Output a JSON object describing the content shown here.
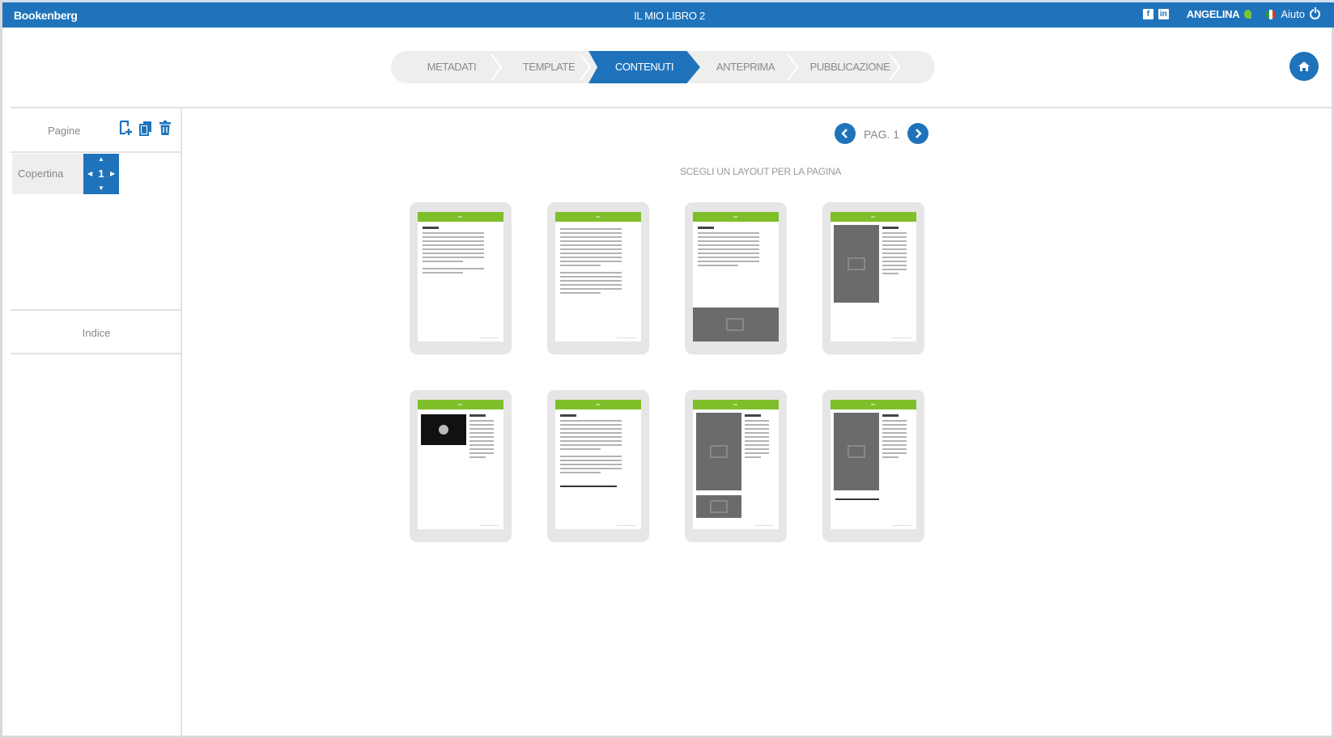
{
  "app": {
    "brand": "Bookenberg",
    "book_title": "IL MIO LIBRO 2",
    "user": "ANGELINA",
    "help_label": "Aiuto"
  },
  "stepper": {
    "steps": [
      "METADATI",
      "TEMPLATE",
      "CONTENUTI",
      "ANTEPRIMA",
      "PUBBLICAZIONE"
    ],
    "active": "CONTENUTI"
  },
  "sidebar": {
    "pages_label": "Pagine",
    "cover_label": "Copertina",
    "cover_page_number": "1",
    "index_label": "Indice"
  },
  "main": {
    "page_label": "PAG. 1",
    "choose_layout_label": "SCEGLI UN LAYOUT PER LA PAGINA",
    "layouts": [
      "text-single-column",
      "text-long",
      "text-with-bottom-image",
      "image-left-text-right",
      "video-left-text-right",
      "text-with-bottom-rule",
      "images-left-text-right",
      "image-left-text-rule"
    ]
  },
  "colors": {
    "accent": "#1f73bb",
    "layout_header": "#7fbf2a",
    "tile_bg": "#e6e6e6"
  }
}
